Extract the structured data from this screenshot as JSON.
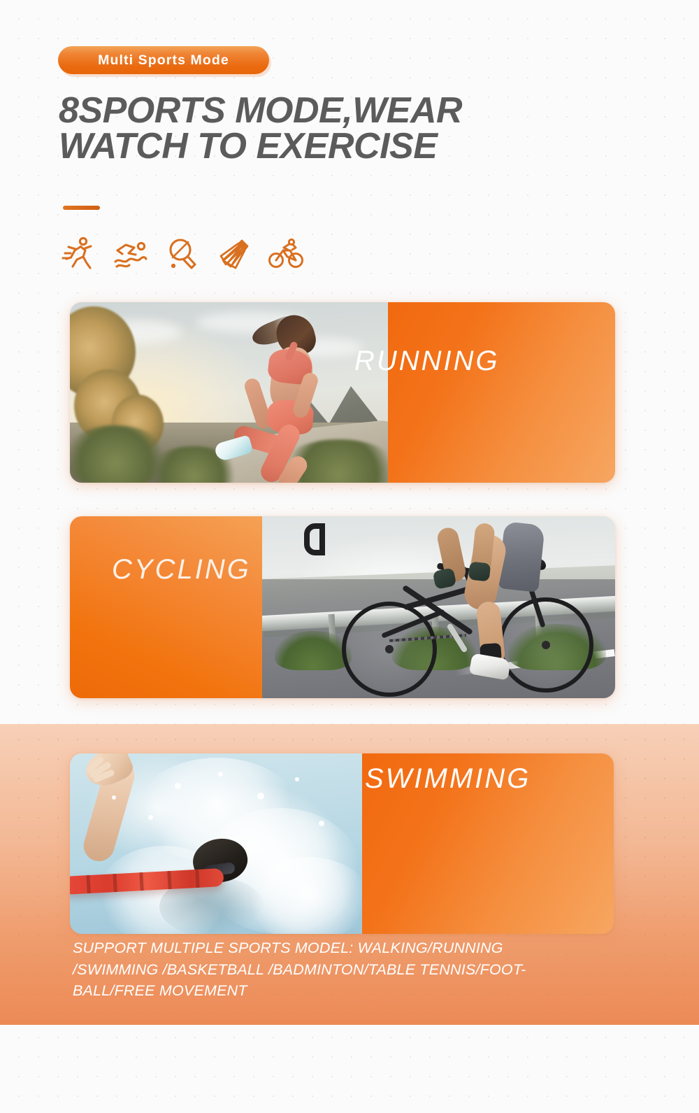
{
  "page": {
    "background_color": "#fbfbfb",
    "accent_color": "#ef7f28",
    "deep_orange": "#ea6a10",
    "light_orange": "#f6a661",
    "peach_band_top": "#f7d0b7",
    "peach_band_bottom": "#ec8a56",
    "headline_color": "#5b5b5b"
  },
  "header": {
    "badge_label": "Multi Sports Mode",
    "headline_line1": "8SPORTS MODE,WEAR",
    "headline_line2": "WATCH TO EXERCISE",
    "divider": "accent-rule"
  },
  "icons": [
    {
      "name": "running-icon",
      "label": "Running"
    },
    {
      "name": "swimming-icon",
      "label": "Swimming"
    },
    {
      "name": "table-tennis-icon",
      "label": "Table Tennis"
    },
    {
      "name": "badminton-icon",
      "label": "Badminton"
    },
    {
      "name": "cycling-icon",
      "label": "Cycling"
    }
  ],
  "cards": [
    {
      "id": "running",
      "label": "RUNNING",
      "image_alt": "Woman running outdoors on a mountain road at sunrise",
      "panel_side": "right"
    },
    {
      "id": "cycling",
      "label": "CYCLING",
      "image_alt": "Cyclist riding a road bike along a guardrail",
      "panel_side": "left"
    },
    {
      "id": "swimming",
      "label": "SWIMMING",
      "image_alt": "Swimmer doing freestyle stroke in a pool with splashing water",
      "panel_side": "right"
    }
  ],
  "caption": {
    "line1": "SUPPORT MULTIPLE SPORTS MODEL: WALKING/RUNNING",
    "line2": "/SWIMMING /BASKETBALL /BADMINTON/TABLE TENNIS/FOOT-",
    "line3": "BALL/FREE MOVEMENT"
  }
}
